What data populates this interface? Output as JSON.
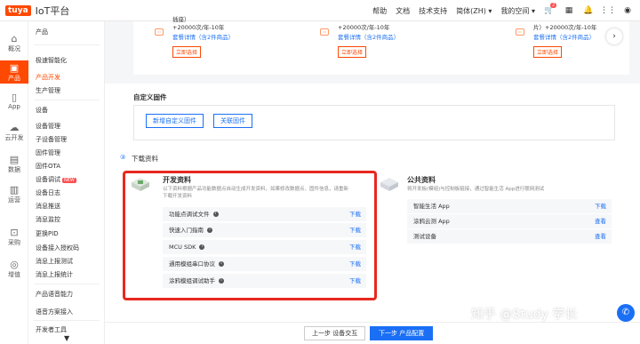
{
  "topbar": {
    "logo_badge": "tuya",
    "title": "IoT平台",
    "nav": [
      "帮助",
      "文档",
      "技术支持"
    ],
    "language": "简体(ZH)",
    "space": "我的空间",
    "cart_badge": "2",
    "accent": "#ff4800"
  },
  "iconbar": [
    {
      "label": "概况",
      "icon": "home-icon"
    },
    {
      "label": "产品",
      "icon": "product-icon"
    },
    {
      "label": "App",
      "icon": "phone-icon"
    },
    {
      "label": "云开发",
      "icon": "cloud-icon"
    },
    {
      "label": "数据",
      "icon": "chart-icon"
    },
    {
      "label": "运营",
      "icon": "ops-icon"
    },
    {
      "label": "采购",
      "icon": "cart-icon"
    },
    {
      "label": "增值",
      "icon": "value-icon"
    }
  ],
  "sidebar": {
    "product": "产品",
    "sec1": "极速智能化",
    "dev": "产品开发",
    "prod_mgmt": "生产管理",
    "sec2": "设备",
    "items": [
      "设备管理",
      "子设备管理",
      "固件管理",
      "固件OTA",
      "设备调试",
      "设备日志",
      "消息推送",
      "消息监控",
      "更换PID",
      "设备接入授权码",
      "消息上报测试",
      "消息上报统计"
    ],
    "new_badge": "NEW",
    "sec3": "产品语音能力",
    "voice": "语音方案接入",
    "sec4": "开发者工具"
  },
  "packages": {
    "cards": [
      {
        "line1": "插座）",
        "line2": "+20000次/年-10年",
        "detail": "套餐详情（含2件商品）",
        "select": "立即选择"
      },
      {
        "line1": "+20000次/年-10年",
        "line2": "",
        "detail": "套餐详情（含2件商品）",
        "select": "立即选择"
      },
      {
        "line1": "片）+20000次/年-10年",
        "line2": "",
        "detail": "套餐详情（含2件商品）",
        "select": "立即选择"
      }
    ]
  },
  "custom_fw": {
    "title": "自定义固件",
    "add": "新增自定义固件",
    "link": "关联固件"
  },
  "download": {
    "step": "③",
    "title": "下载资料",
    "dev": {
      "title": "开发资料",
      "desc1": "以下资料根据产品功能数据点自动生成开发资料，如果修改数据点、固件信息，请重新",
      "desc2": "下载开发资料",
      "action": "下载",
      "items": [
        "功能点调试文件",
        "快速入门指南",
        "MCU SDK",
        "通用模组串口协议",
        "涂鸦模组调试助手"
      ]
    },
    "public": {
      "title": "公共资料",
      "desc": "将开发板(模组)与控制板链接，通过智能生活 App进行联网测试",
      "items": [
        {
          "name": "智能生活 App",
          "action": "下载"
        },
        {
          "name": "涂鸦云测 App",
          "action": "查看"
        },
        {
          "name": "测试设备",
          "action": "查看"
        }
      ]
    }
  },
  "bottom": {
    "prev": "上一步 设备交互",
    "next": "下一步 产品配置"
  },
  "watermark": "知乎 @Study 学长",
  "colors": {
    "link": "#1a6ff5",
    "highlight_border": "#e8281f"
  }
}
